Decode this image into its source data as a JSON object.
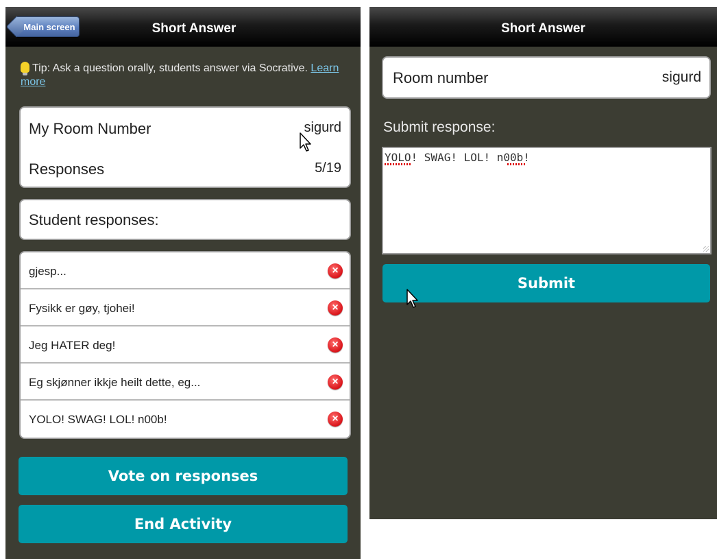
{
  "left_screen": {
    "header": {
      "back_label": "Main screen",
      "title": "Short Answer"
    },
    "tip": {
      "text": "Tip: Ask a question orally, students answer via Socrative.",
      "link": "Learn more"
    },
    "info": {
      "room_label": "My Room Number",
      "room_value": "sigurd",
      "responses_label": "Responses",
      "responses_value": "5/19"
    },
    "responses_header": "Student responses:",
    "responses": [
      {
        "text": "gjesp..."
      },
      {
        "text": "Fysikk er gøy, tjohei!"
      },
      {
        "text": "Jeg HATER deg!"
      },
      {
        "text": "Eg skjønner ikkje heilt dette, eg..."
      },
      {
        "text": "YOLO! SWAG! LOL! n00b!"
      }
    ],
    "buttons": {
      "vote": "Vote on responses",
      "end": "End Activity"
    }
  },
  "right_screen": {
    "header": {
      "title": "Short Answer"
    },
    "room_label": "Room number",
    "room_value": "sigurd",
    "submit_label": "Submit response:",
    "response_text": "YOLO! SWAG! LOL! n00b!",
    "submit_button": "Submit"
  },
  "colors": {
    "panel_bg": "#3c3d33",
    "accent": "#0099a8",
    "back_button": "#5b7fbf",
    "delete_icon": "#d9141a",
    "link": "#7cc6e8"
  },
  "icons": [
    "lightbulb-icon",
    "delete-icon",
    "mouse-cursor-icon"
  ]
}
